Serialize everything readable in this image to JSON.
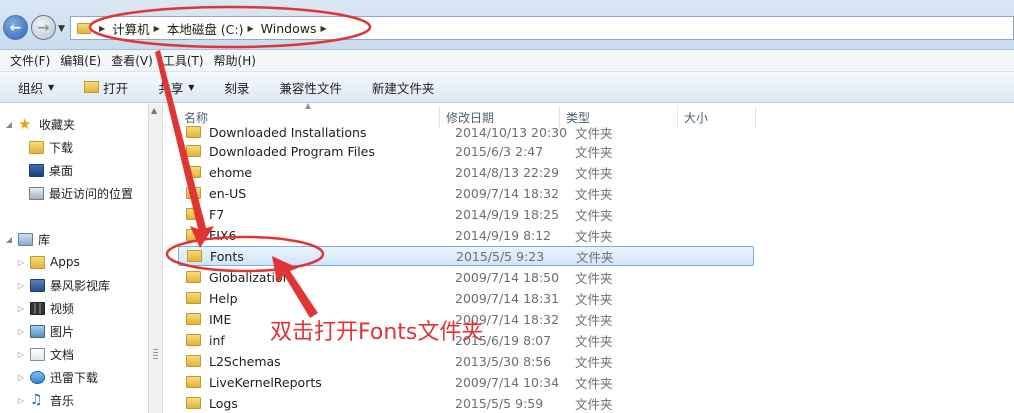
{
  "address": {
    "crumbs": [
      "计算机",
      "本地磁盘 (C:)",
      "Windows"
    ]
  },
  "menu": {
    "items": [
      "文件(F)",
      "编辑(E)",
      "查看(V)",
      "工具(T)",
      "帮助(H)"
    ]
  },
  "toolbar": {
    "organize": "组织",
    "open": "打开",
    "share": "共享",
    "burn": "刻录",
    "compat": "兼容性文件",
    "new_folder": "新建文件夹"
  },
  "nav": {
    "favorites": "收藏夹",
    "downloads": "下载",
    "desktop": "桌面",
    "recent": "最近访问的位置",
    "libraries": "库",
    "apps": "Apps",
    "baofeng": "暴风影视库",
    "videos": "视频",
    "pictures": "图片",
    "documents": "文档",
    "xunlei": "迅雷下载",
    "music": "音乐"
  },
  "columns": {
    "name": "名称",
    "date": "修改日期",
    "type": "类型",
    "size": "大小"
  },
  "files": [
    {
      "name": "Downloaded Installations",
      "date": "2014/10/13 20:30",
      "type": "文件夹"
    },
    {
      "name": "Downloaded Program Files",
      "date": "2015/6/3 2:47",
      "type": "文件夹"
    },
    {
      "name": "ehome",
      "date": "2014/8/13 22:29",
      "type": "文件夹"
    },
    {
      "name": "en-US",
      "date": "2009/7/14 18:32",
      "type": "文件夹"
    },
    {
      "name": "F7",
      "date": "2014/9/19 18:25",
      "type": "文件夹"
    },
    {
      "name": "FIX6",
      "date": "2014/9/19 8:12",
      "type": "文件夹"
    },
    {
      "name": "Fonts",
      "date": "2015/5/5 9:23",
      "type": "文件夹",
      "selected": true
    },
    {
      "name": "Globalization",
      "date": "2009/7/14 18:50",
      "type": "文件夹"
    },
    {
      "name": "Help",
      "date": "2009/7/14 18:31",
      "type": "文件夹"
    },
    {
      "name": "IME",
      "date": "2009/7/14 18:32",
      "type": "文件夹"
    },
    {
      "name": "inf",
      "date": "2015/6/19 8:07",
      "type": "文件夹"
    },
    {
      "name": "L2Schemas",
      "date": "2013/5/30 8:56",
      "type": "文件夹"
    },
    {
      "name": "LiveKernelReports",
      "date": "2009/7/14 10:34",
      "type": "文件夹"
    },
    {
      "name": "Logs",
      "date": "2015/5/5 9:59",
      "type": "文件夹"
    }
  ],
  "annotation": {
    "text": "双击打开Fonts文件夹",
    "color": "#e03535"
  }
}
